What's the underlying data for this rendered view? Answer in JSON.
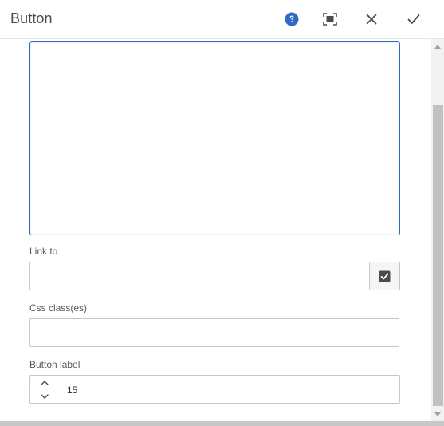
{
  "dialog": {
    "title": "Button",
    "actions": {
      "help_icon": "help-icon",
      "fullscreen_icon": "fullscreen-icon",
      "close_icon": "close-icon",
      "done_icon": "check-icon"
    }
  },
  "form": {
    "text_value": "",
    "link_label": "Link to",
    "link_value": "",
    "css_label": "Css class(es)",
    "css_value": "",
    "button_label_label": "Button label",
    "button_label_value": "15"
  },
  "colors": {
    "accent": "#2d6bc4",
    "help": "#2d6bc4"
  }
}
